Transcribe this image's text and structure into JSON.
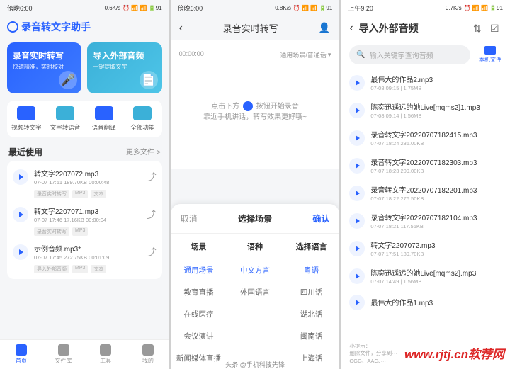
{
  "screen1": {
    "status": {
      "time": "傍晚6:00",
      "net": "0.6K/s",
      "icons": "⏰ 📶 📶 🔋91"
    },
    "app_title": "录音转文字助手",
    "cards": [
      {
        "title": "录音实时转写",
        "sub": "快速精准，实时校对"
      },
      {
        "title": "导入外部音频",
        "sub": "一键提取文字"
      }
    ],
    "grid": [
      {
        "label": "视频转文字"
      },
      {
        "label": "文字转语音"
      },
      {
        "label": "语音翻译"
      },
      {
        "label": "全部功能"
      }
    ],
    "section_title": "最近使用",
    "section_more": "更多文件 >",
    "files": [
      {
        "name": "转文字2207072.mp3",
        "meta": "07-07 17:51  189.70KB  00:00:48",
        "tags": [
          "录音实时转写",
          "MP3",
          "文本"
        ]
      },
      {
        "name": "转文字2207071.mp3",
        "meta": "07-07 17:46  17.16KB  00:00:04",
        "tags": [
          "录音实时转写",
          "MP3"
        ]
      },
      {
        "name": "示例音频.mp3*",
        "meta": "07-07 17:45  272.75KB  00:01:09",
        "tags": [
          "导入外部音频",
          "MP3",
          "文本"
        ]
      }
    ],
    "nav": [
      {
        "label": "首页"
      },
      {
        "label": "文件库"
      },
      {
        "label": "工具"
      },
      {
        "label": "我的"
      }
    ]
  },
  "screen2": {
    "status": {
      "time": "傍晚6:00",
      "net": "0.8K/s",
      "icons": "⏰ 📶 📶 🔋91"
    },
    "title": "录音实时转写",
    "time_label": "00:00:00",
    "scene_label": "通用场景/普通话",
    "hint_pre": "点击下方",
    "hint_post": "按钮开始录音",
    "hint_line2": "靠近手机讲话，转写效果更好哦~",
    "sheet": {
      "cancel": "取消",
      "title": "选择场景",
      "confirm": "确认",
      "col_headers": [
        "场景",
        "语种",
        "选择语言"
      ],
      "cols": [
        [
          "通用场景",
          "教育直播",
          "在线医疗",
          "会议演讲",
          "新闻媒体直播"
        ],
        [
          "中文方言",
          "外国语言"
        ],
        [
          "粤语",
          "四川话",
          "湖北话",
          "闽南话",
          "上海话"
        ]
      ],
      "selected": [
        0,
        0,
        0
      ]
    }
  },
  "screen3": {
    "status": {
      "time": "上午9:20",
      "net": "0.7K/s",
      "icons": "⏰ 📶 📶 🔋91"
    },
    "title": "导入外部音频",
    "search_placeholder": "输入关键字查询音频",
    "tab_label": "本机文件",
    "items": [
      {
        "name": "最伟大的作品2.mp3",
        "meta": "07-08 09:15 | 1.75MB"
      },
      {
        "name": "陈奕迅遥远的她Live[mqms2]1.mp3",
        "meta": "07-08 09:14 | 1.56MB"
      },
      {
        "name": "录音转文字20220707182415.mp3",
        "meta": "07-07 18:24  236.00KB"
      },
      {
        "name": "录音转文字20220707182303.mp3",
        "meta": "07-07 18:23  209.00KB"
      },
      {
        "name": "录音转文字20220707182201.mp3",
        "meta": "07-07 18:22  276.50KB"
      },
      {
        "name": "录音转文字20220707182104.mp3",
        "meta": "07-07 18:21  117.56KB"
      },
      {
        "name": "转文字2207072.mp3",
        "meta": "07-07 17:51  189.70KB"
      },
      {
        "name": "陈奕迅遥远的她Live[mqms2].mp3",
        "meta": "07-07 14:49 | 1.56MB"
      },
      {
        "name": "最伟大的作品1.mp3",
        "meta": ""
      }
    ],
    "tip_title": "小提示：",
    "tip_line1": "删除文件，分享到···",
    "tip_line2": "OGG、AAC、···"
  },
  "watermark": "www.rjtj.cn软荐网",
  "attribution": "头条 @手机科技先锋"
}
